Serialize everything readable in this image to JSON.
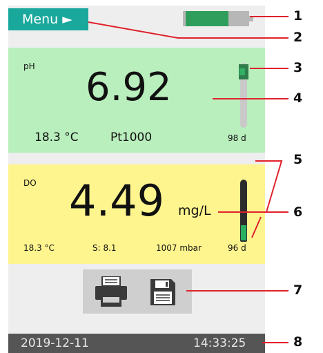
{
  "menu": {
    "label": "Menu ►"
  },
  "battery": {
    "level": 0.7
  },
  "ph": {
    "label": "pH",
    "value": "6.92",
    "temperature": "18.3 °C",
    "sensor_type": "Pt1000",
    "days": "98 d"
  },
  "do": {
    "label": "DO",
    "value": "4.49",
    "unit": "mg/L",
    "temperature": "18.3 °C",
    "salinity": "S: 8.1",
    "pressure": "1007 mbar",
    "days": "96 d"
  },
  "status": {
    "date": "2019-12-11",
    "time": "14:33:25"
  },
  "callouts": [
    "1",
    "2",
    "3",
    "4",
    "5",
    "6",
    "7",
    "8"
  ],
  "colors": {
    "menu_bg": "#1aa89c",
    "ph_bg": "#b9eebd",
    "do_bg": "#fff58f",
    "status_bg": "#555555",
    "battery_fill": "#2f9e5c"
  }
}
